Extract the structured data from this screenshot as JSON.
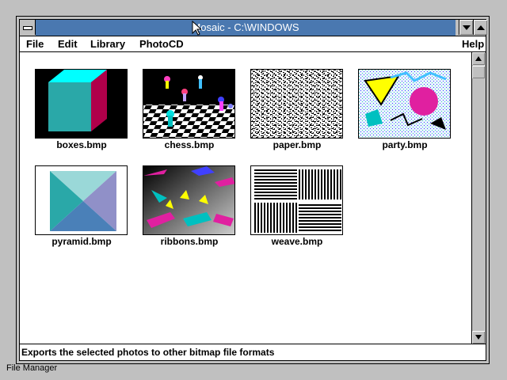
{
  "window": {
    "title": "Mosaic - C:\\WINDOWS"
  },
  "menu": {
    "file": "File",
    "edit": "Edit",
    "library": "Library",
    "photocd": "PhotoCD",
    "help": "Help"
  },
  "files": [
    {
      "name": "boxes.bmp"
    },
    {
      "name": "chess.bmp"
    },
    {
      "name": "paper.bmp"
    },
    {
      "name": "party.bmp"
    },
    {
      "name": "pyramid.bmp"
    },
    {
      "name": "ribbons.bmp"
    },
    {
      "name": "weave.bmp"
    }
  ],
  "status": {
    "text": "Exports the selected photos to other bitmap file formats"
  },
  "desktop": {
    "file_manager_label": "File Manager"
  },
  "icons": {
    "system_menu": "system-menu-icon",
    "minimize": "minimize-arrow-icon",
    "maximize": "maximize-arrow-icon",
    "scroll_up": "scroll-up-arrow-icon",
    "scroll_down": "scroll-down-arrow-icon",
    "cursor": "mouse-pointer-icon"
  },
  "colors": {
    "title_bar": "#4a78b0",
    "window_frame": "#c0c0c0",
    "desktop": "#c0c0c0"
  }
}
